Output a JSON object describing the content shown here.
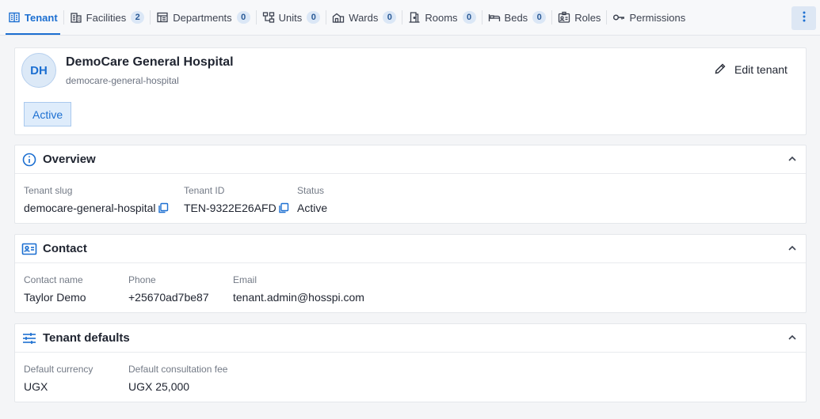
{
  "tabs": [
    {
      "label": "Tenant",
      "icon": "building-icon",
      "active": true
    },
    {
      "label": "Facilities",
      "icon": "facilities-icon",
      "badge": "2"
    },
    {
      "label": "Departments",
      "icon": "departments-icon",
      "badge": "0"
    },
    {
      "label": "Units",
      "icon": "units-icon",
      "badge": "0"
    },
    {
      "label": "Wards",
      "icon": "wards-icon",
      "badge": "0"
    },
    {
      "label": "Rooms",
      "icon": "rooms-icon",
      "badge": "0"
    },
    {
      "label": "Beds",
      "icon": "bed-icon",
      "badge": "0"
    },
    {
      "label": "Roles",
      "icon": "roles-icon"
    },
    {
      "label": "Permissions",
      "icon": "key-icon"
    }
  ],
  "tenant": {
    "initials": "DH",
    "name": "DemoCare General Hospital",
    "slug": "democare-general-hospital",
    "status": "Active",
    "edit_label": "Edit tenant"
  },
  "overview": {
    "title": "Overview",
    "fields": [
      {
        "label": "Tenant slug",
        "value": "democare-general-hospital",
        "copyable": true
      },
      {
        "label": "Tenant ID",
        "value": "TEN-9322E26AFD",
        "copyable": true
      },
      {
        "label": "Status",
        "value": "Active"
      }
    ]
  },
  "contact": {
    "title": "Contact",
    "fields": [
      {
        "label": "Contact name",
        "value": "Taylor Demo"
      },
      {
        "label": "Phone",
        "value": "+25670ad7be87"
      },
      {
        "label": "Email",
        "value": "tenant.admin@hosspi.com"
      }
    ]
  },
  "defaults": {
    "title": "Tenant defaults",
    "fields": [
      {
        "label": "Default currency",
        "value": "UGX"
      },
      {
        "label": "Default consultation fee",
        "value": "UGX 25,000"
      }
    ]
  },
  "colors": {
    "accent": "#1c6fd1",
    "badge_bg": "#dbe7f6",
    "page_bg": "#f4f5f7"
  }
}
